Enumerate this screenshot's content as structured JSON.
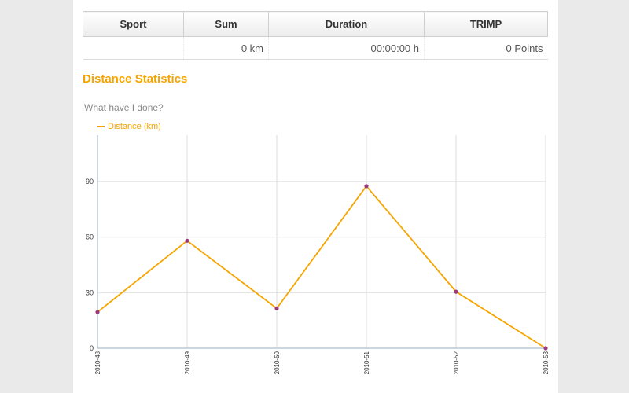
{
  "summary_table": {
    "headers": [
      "Sport",
      "Sum",
      "Duration",
      "TRIMP"
    ],
    "rows": [
      [
        "",
        "0 km",
        "00:00:00 h",
        "0 Points"
      ]
    ]
  },
  "section_title": "Distance Statistics",
  "chart_subtitle": "What have I done?",
  "legend_label": "Distance (km)",
  "colors": {
    "accent": "#f5a500",
    "point": "#9b3a7a",
    "grid": "#dcdcdc",
    "axis": "#b9c9d9"
  },
  "chart_data": {
    "type": "line",
    "title": "What have I done?",
    "categories": [
      "2010-48",
      "2010-49",
      "2010-50",
      "2010-51",
      "2010-52",
      "2010-53"
    ],
    "series": [
      {
        "name": "Distance (km)",
        "values": [
          19.5,
          58,
          21.5,
          87.5,
          30.5,
          0
        ]
      }
    ],
    "yticks": [
      0,
      30,
      60,
      90
    ],
    "ylim": [
      0,
      115
    ],
    "grid": true,
    "legend": "top-left"
  }
}
